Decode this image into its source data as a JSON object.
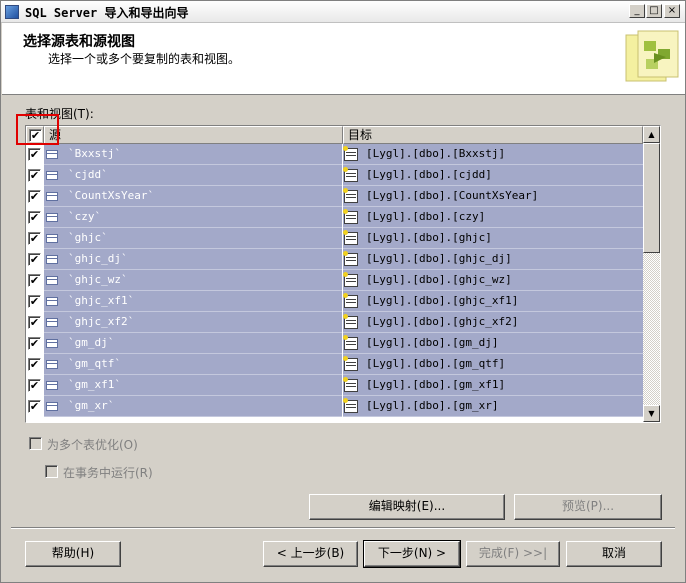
{
  "window": {
    "title": "SQL Server 导入和导出向导",
    "controls": [
      "_",
      "□",
      "×"
    ]
  },
  "header": {
    "title": "选择源表和源视图",
    "subtitle": "选择一个或多个要复制的表和视图。"
  },
  "tables_label": "表和视图(T):",
  "grid": {
    "columns": {
      "source": "源",
      "destination": "目标"
    },
    "select_all_checked": "✔",
    "rows": [
      {
        "checked": "✔",
        "source": "`Bxxstj`",
        "destination": "[Lygl].[dbo].[Bxxstj]"
      },
      {
        "checked": "✔",
        "source": "`cjdd`",
        "destination": "[Lygl].[dbo].[cjdd]"
      },
      {
        "checked": "✔",
        "source": "`CountXsYear`",
        "destination": "[Lygl].[dbo].[CountXsYear]"
      },
      {
        "checked": "✔",
        "source": "`czy`",
        "destination": "[Lygl].[dbo].[czy]"
      },
      {
        "checked": "✔",
        "source": "`ghjc`",
        "destination": "[Lygl].[dbo].[ghjc]"
      },
      {
        "checked": "✔",
        "source": "`ghjc_dj`",
        "destination": "[Lygl].[dbo].[ghjc_dj]"
      },
      {
        "checked": "✔",
        "source": "`ghjc_wz`",
        "destination": "[Lygl].[dbo].[ghjc_wz]"
      },
      {
        "checked": "✔",
        "source": "`ghjc_xf1`",
        "destination": "[Lygl].[dbo].[ghjc_xf1]"
      },
      {
        "checked": "✔",
        "source": "`ghjc_xf2`",
        "destination": "[Lygl].[dbo].[ghjc_xf2]"
      },
      {
        "checked": "✔",
        "source": "`gm_dj`",
        "destination": "[Lygl].[dbo].[gm_dj]"
      },
      {
        "checked": "✔",
        "source": "`gm_qtf`",
        "destination": "[Lygl].[dbo].[gm_qtf]"
      },
      {
        "checked": "✔",
        "source": "`gm_xf1`",
        "destination": "[Lygl].[dbo].[gm_xf1]"
      },
      {
        "checked": "✔",
        "source": "`gm_xr`",
        "destination": "[Lygl].[dbo].[gm_xr]"
      }
    ]
  },
  "options": {
    "optimize_multiple": "为多个表优化(O)",
    "run_in_transaction": "在事务中运行(R)"
  },
  "buttons": {
    "edit_mappings": "编辑映射(E)...",
    "preview": "预览(P)...",
    "help": "帮助(H)",
    "back": "< 上一步(B)",
    "next": "下一步(N) >",
    "finish": "完成(F) >>|",
    "cancel": "取消"
  },
  "colors": {
    "selected_row": "#a3a9c9",
    "annotation_box": "#e00000"
  }
}
